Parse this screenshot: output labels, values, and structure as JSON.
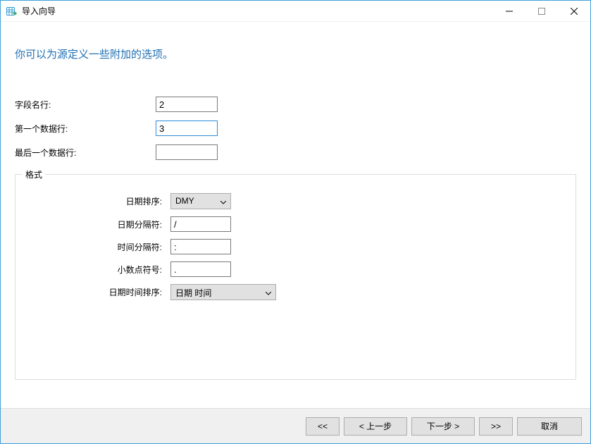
{
  "window": {
    "title": "导入向导"
  },
  "headline": "你可以为源定义一些附加的选项。",
  "rows": {
    "field_name_row": {
      "label": "字段名行:",
      "value": "2"
    },
    "first_data_row": {
      "label": "第一个数据行:",
      "value": "3"
    },
    "last_data_row": {
      "label": "最后一个数据行:",
      "value": ""
    }
  },
  "format": {
    "legend": "格式",
    "date_order": {
      "label": "日期排序:",
      "value": "DMY"
    },
    "date_separator": {
      "label": "日期分隔符:",
      "value": "/"
    },
    "time_separator": {
      "label": "时间分隔符:",
      "value": ":"
    },
    "decimal_symbol": {
      "label": "小数点符号:",
      "value": "."
    },
    "datetime_order": {
      "label": "日期时间排序:",
      "value": "日期 时间"
    }
  },
  "buttons": {
    "first": "<<",
    "prev": "< 上一步",
    "next": "下一步 >",
    "last": ">>",
    "cancel": "取消"
  }
}
